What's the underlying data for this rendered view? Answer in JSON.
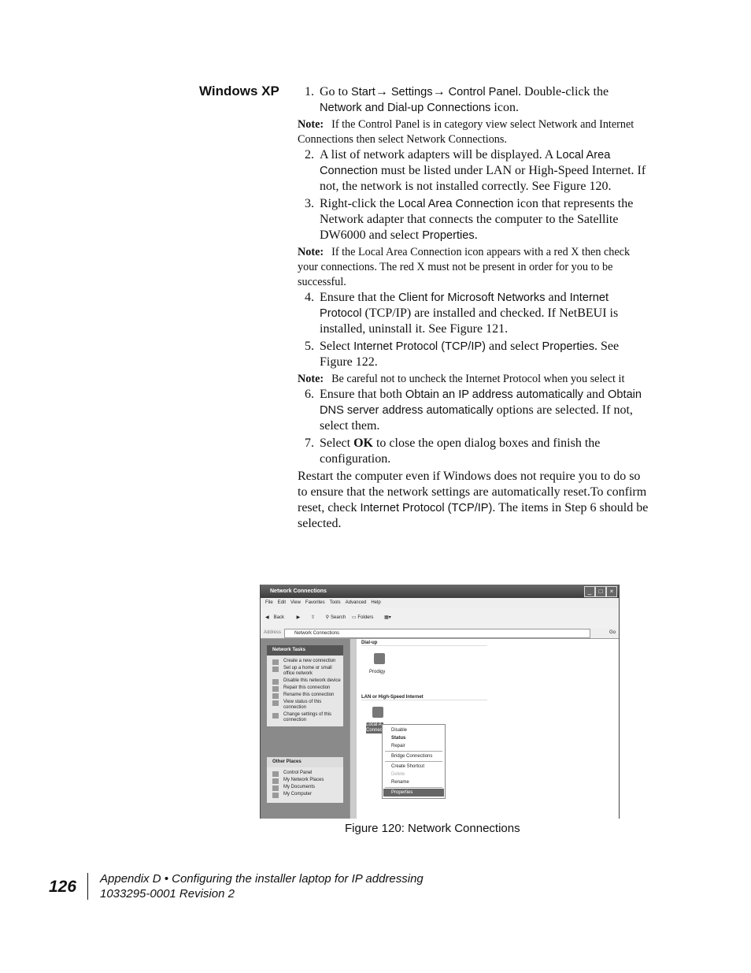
{
  "section_title": "Windows XP",
  "body": [
    {
      "type": "step",
      "num": "1.",
      "segs": [
        {
          "t": "Go to "
        },
        {
          "t": "Start",
          "s": 1
        },
        {
          "t": "→ "
        },
        {
          "t": "Settings",
          "s": 1
        },
        {
          "t": "→ "
        },
        {
          "t": "Control Panel",
          "s": 1
        },
        {
          "t": ". Double-click the "
        },
        {
          "t": "Network and Dial-up Connections",
          "s": 1
        },
        {
          "t": " icon."
        }
      ]
    },
    {
      "type": "note",
      "label": "Note:",
      "segs": [
        {
          "t": "If the Control Panel is in category view select Network and Internet Connections then select Network Connections."
        }
      ]
    },
    {
      "type": "step",
      "num": "2.",
      "segs": [
        {
          "t": "A list of network adapters will be displayed. A "
        },
        {
          "t": "Local Area Connection",
          "s": 1
        },
        {
          "t": " must be listed under LAN or High-Speed Internet. If not, the network is not installed correctly. See Figure 120."
        }
      ]
    },
    {
      "type": "step",
      "num": "3.",
      "segs": [
        {
          "t": "Right-click the "
        },
        {
          "t": "Local Area Connection",
          "s": 1
        },
        {
          "t": " icon that represents the Network adapter that connects the computer to the Satellite DW6000 and select "
        },
        {
          "t": "Properties",
          "s": 1
        },
        {
          "t": "."
        }
      ]
    },
    {
      "type": "note",
      "label": "Note:",
      "segs": [
        {
          "t": "If the Local Area Connection icon appears with a red X then check your connections. The red X must not be present in order for you to be successful."
        }
      ]
    },
    {
      "type": "step",
      "num": "4.",
      "segs": [
        {
          "t": "Ensure that the "
        },
        {
          "t": "Client for Microsoft Networks",
          "s": 1
        },
        {
          "t": " and "
        },
        {
          "t": "Internet Protocol",
          "s": 1
        },
        {
          "t": " (TCP/IP) are installed and checked. If NetBEUI is installed, uninstall it. See Figure 121."
        }
      ]
    },
    {
      "type": "step",
      "num": "5.",
      "segs": [
        {
          "t": "Select "
        },
        {
          "t": "Internet Protocol (TCP/IP)",
          "s": 1
        },
        {
          "t": " and select "
        },
        {
          "t": "Properties",
          "s": 1
        },
        {
          "t": ". See Figure 122."
        }
      ]
    },
    {
      "type": "note",
      "label": "Note:",
      "segs": [
        {
          "t": "Be careful not to uncheck the Internet Protocol when you select it"
        }
      ]
    },
    {
      "type": "step",
      "num": "6.",
      "segs": [
        {
          "t": "Ensure that both "
        },
        {
          "t": "Obtain an IP address automatically",
          "s": 1
        },
        {
          "t": " and "
        },
        {
          "t": "Obtain DNS server address automatically",
          "s": 1
        },
        {
          "t": " options are selected. If not, select them."
        }
      ]
    },
    {
      "type": "step",
      "num": "7.",
      "segs": [
        {
          "t": "Select "
        },
        {
          "t": "OK",
          "b": 1
        },
        {
          "t": " to close the open dialog boxes and finish the configuration."
        }
      ]
    },
    {
      "type": "para",
      "segs": [
        {
          "t": "Restart the computer even if Windows does not require you to do so to ensure that the network settings are automatically reset.To confirm reset, check "
        },
        {
          "t": "Internet Protocol (TCP/IP)",
          "s": 1
        },
        {
          "t": ".  The items in Step 6 should be selected."
        }
      ]
    }
  ],
  "figure": {
    "title": "Network Connections",
    "menu": [
      "File",
      "Edit",
      "View",
      "Favorites",
      "Tools",
      "Advanced",
      "Help"
    ],
    "toolbar": {
      "back": "Back",
      "search": "Search",
      "folders": "Folders"
    },
    "address_label": "Address",
    "address_value": "Network Connections",
    "go": "Go",
    "network_tasks": {
      "title": "Network Tasks",
      "items": [
        "Create a new connection",
        "Set up a home or small office network",
        "Disable this network device",
        "Repair this connection",
        "Rename this connection",
        "View status of this connection",
        "Change settings of this connection"
      ]
    },
    "other_places": {
      "title": "Other Places",
      "items": [
        "Control Panel",
        "My Network Places",
        "My Documents",
        "My Computer"
      ]
    },
    "groups": {
      "dialup": "Dial-up",
      "lan": "LAN or High-Speed Internet"
    },
    "prodigy": "Prodigy",
    "local_label": [
      "Local A",
      "Connec"
    ],
    "context_menu": [
      "Disable",
      "Status",
      "Repair",
      "Bridge Connections",
      "Create Shortcut",
      "Delete",
      "Rename",
      "Properties"
    ],
    "caption": "Figure 120:  Network Connections"
  },
  "footer": {
    "page_number": "126",
    "line1": "Appendix D • Configuring the installer laptop for IP addressing",
    "line2": "1033295-0001  Revision 2"
  }
}
